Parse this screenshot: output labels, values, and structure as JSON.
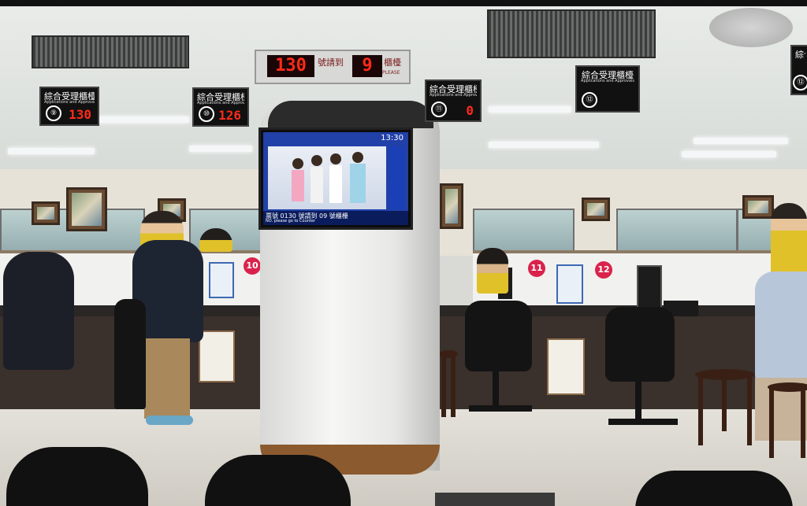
{
  "main_counter": {
    "number": "130",
    "label_a": "號請到",
    "counter": "9",
    "label_b": "櫃檯",
    "label_en": "PLEASE"
  },
  "overhead_signs": [
    {
      "title": "綜合受理櫃檯",
      "subtitle": "Applications and Approvals",
      "badge": "⑨",
      "value": "130"
    },
    {
      "title": "綜合受理櫃檯",
      "subtitle": "Applications and Approvals",
      "badge": "⑩",
      "value": "126"
    },
    {
      "title": "綜合受理櫃檯",
      "subtitle": "Applications and Approvals",
      "badge": "⑪",
      "value": "0"
    },
    {
      "title": "綜合受理櫃檯",
      "subtitle": "Applications and Approvals",
      "badge": "⑫",
      "value": ""
    },
    {
      "title": "綜合受理櫃檯",
      "subtitle": "",
      "badge": "⑫",
      "value": ""
    }
  ],
  "tv": {
    "time": "13:30",
    "ticker_a": "票號 0130 號請到 09 號櫃檯",
    "ticker_a_en": "NO.    please go to    Counter",
    "ticker_b": "票號 0130 請到 09 號櫃檯"
  },
  "counter_numbers": [
    "10",
    "11",
    "12"
  ],
  "colors": {
    "led": "#ff2a1a",
    "counter_badge": "#d9234c",
    "tv_blue": "#2140a8",
    "pillar_base": "#8b5a2e"
  }
}
